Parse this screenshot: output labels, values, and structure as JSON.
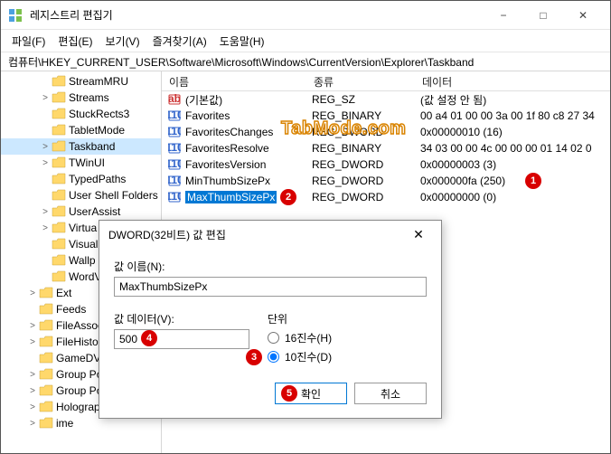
{
  "window": {
    "title": "레지스트리 편집기",
    "path": "컴퓨터\\HKEY_CURRENT_USER\\Software\\Microsoft\\Windows\\CurrentVersion\\Explorer\\Taskband"
  },
  "menu": {
    "file": "파일(F)",
    "edit": "편집(E)",
    "view": "보기(V)",
    "favorites": "즐겨찾기(A)",
    "help": "도움말(H)"
  },
  "tree": {
    "items": [
      {
        "label": "StreamMRU",
        "indent": 3,
        "expand": "",
        "open": false
      },
      {
        "label": "Streams",
        "indent": 3,
        "expand": ">",
        "open": false
      },
      {
        "label": "StuckRects3",
        "indent": 3,
        "expand": "",
        "open": false
      },
      {
        "label": "TabletMode",
        "indent": 3,
        "expand": "",
        "open": false
      },
      {
        "label": "Taskband",
        "indent": 3,
        "expand": ">",
        "open": true,
        "selected": true
      },
      {
        "label": "TWinUI",
        "indent": 3,
        "expand": ">",
        "open": false
      },
      {
        "label": "TypedPaths",
        "indent": 3,
        "expand": "",
        "open": false
      },
      {
        "label": "User Shell Folders",
        "indent": 3,
        "expand": "",
        "open": false
      },
      {
        "label": "UserAssist",
        "indent": 3,
        "expand": ">",
        "open": false
      },
      {
        "label": "Virtua",
        "indent": 3,
        "expand": ">",
        "open": false
      },
      {
        "label": "Visual",
        "indent": 3,
        "expand": "",
        "open": false
      },
      {
        "label": "Wallp",
        "indent": 3,
        "expand": "",
        "open": false
      },
      {
        "label": "WordV",
        "indent": 3,
        "expand": "",
        "open": false
      },
      {
        "label": "Ext",
        "indent": 2,
        "expand": ">",
        "open": false
      },
      {
        "label": "Feeds",
        "indent": 2,
        "expand": "",
        "open": false
      },
      {
        "label": "FileAssoc",
        "indent": 2,
        "expand": ">",
        "open": false
      },
      {
        "label": "FileHisto",
        "indent": 2,
        "expand": ">",
        "open": false
      },
      {
        "label": "GameDV",
        "indent": 2,
        "expand": "",
        "open": false
      },
      {
        "label": "Group Po",
        "indent": 2,
        "expand": ">",
        "open": false
      },
      {
        "label": "Group Po",
        "indent": 2,
        "expand": ">",
        "open": false
      },
      {
        "label": "Holograp",
        "indent": 2,
        "expand": ">",
        "open": false
      },
      {
        "label": "ime",
        "indent": 2,
        "expand": ">",
        "open": false
      }
    ]
  },
  "list": {
    "headers": {
      "name": "이름",
      "type": "종류",
      "data": "데이터"
    },
    "rows": [
      {
        "icon": "str",
        "name": "(기본값)",
        "type": "REG_SZ",
        "data": "(값 설정 안 됨)"
      },
      {
        "icon": "bin",
        "name": "Favorites",
        "type": "REG_BINARY",
        "data": "00 a4 01 00 00 3a 00 1f 80 c8 27 34"
      },
      {
        "icon": "bin",
        "name": "FavoritesChanges",
        "type": "REG_DWORD",
        "data": "0x00000010 (16)"
      },
      {
        "icon": "bin",
        "name": "FavoritesResolve",
        "type": "REG_BINARY",
        "data": "34 03 00 00 4c 00 00 00 01 14 02 0"
      },
      {
        "icon": "bin",
        "name": "FavoritesVersion",
        "type": "REG_DWORD",
        "data": "0x00000003 (3)"
      },
      {
        "icon": "bin",
        "name": "MinThumbSizePx",
        "type": "REG_DWORD",
        "data": "0x000000fa (250)"
      },
      {
        "icon": "bin",
        "name": "MaxThumbSizePx",
        "type": "REG_DWORD",
        "data": "0x00000000 (0)",
        "selected": true
      }
    ]
  },
  "dialog": {
    "title": "DWORD(32비트) 값 편집",
    "name_label": "값 이름(N):",
    "name_value": "MaxThumbSizePx",
    "data_label": "값 데이터(V):",
    "data_value": "500",
    "base_label": "단위",
    "hex_label": "16진수(H)",
    "dec_label": "10진수(D)",
    "ok": "확인",
    "cancel": "취소"
  },
  "badges": {
    "b1": "1",
    "b2": "2",
    "b3": "3",
    "b4": "4",
    "b5": "5"
  },
  "watermark": "TabMode.com"
}
